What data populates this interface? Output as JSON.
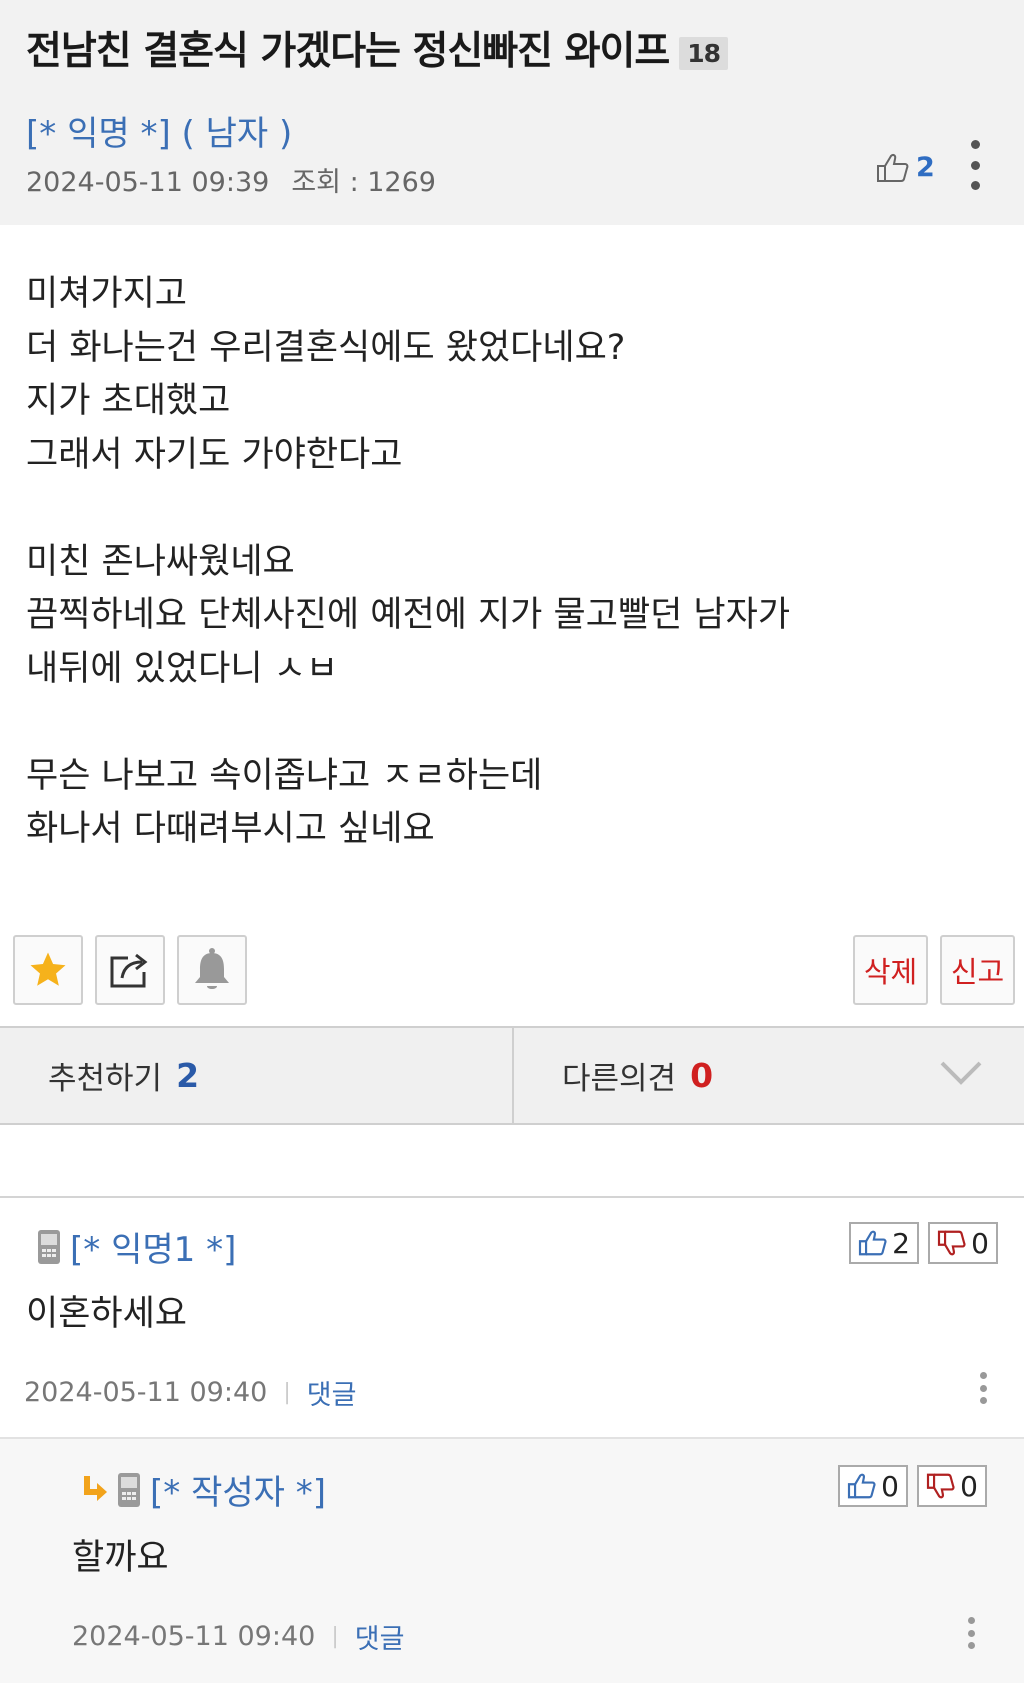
{
  "post": {
    "title": "전남친 결혼식 가겠다는 정신빠진 와이프",
    "comment_count_badge": "18",
    "author": "[* 익명 *] ( 남자 )",
    "date": "2024-05-11 09:39",
    "views_label": "조회 : 1269",
    "likes": "2",
    "body_lines": [
      "미쳐가지고",
      "더 화나는건 우리결혼식에도 왔었다네요?",
      "지가 초대했고",
      "그래서 자기도 가야한다고",
      "",
      "미친 존나싸웠네요",
      "끔찍하네요 단체사진에 예전에 지가 물고빨던 남자가",
      "내뒤에 있었다니 ㅅㅂ",
      "",
      "무슨 나보고 속이좁냐고 ㅈㄹ하는데",
      "화나서 다때려부시고 싶네요"
    ]
  },
  "actions": {
    "favorite_icon": "star-icon",
    "share_icon": "share-icon",
    "notify_icon": "bell-icon",
    "delete_label": "삭제",
    "report_label": "신고"
  },
  "tabs": {
    "recommend_label": "추천하기",
    "recommend_count": "2",
    "other_label": "다른의견",
    "other_count": "0"
  },
  "comments": [
    {
      "author": "[* 익명1 *]",
      "text": "이혼하세요",
      "date": "2024-05-11 09:40",
      "reply_label": "댓글",
      "up": "2",
      "down": "0"
    },
    {
      "author": "[* 작성자 *]",
      "text": "할까요",
      "date": "2024-05-11 09:40",
      "reply_label": "댓글",
      "up": "0",
      "down": "0"
    }
  ],
  "colors": {
    "link_blue": "#3b6fb5",
    "count_blue": "#2a5aa8",
    "count_red": "#d02020",
    "header_bg": "#f2f2f2"
  }
}
